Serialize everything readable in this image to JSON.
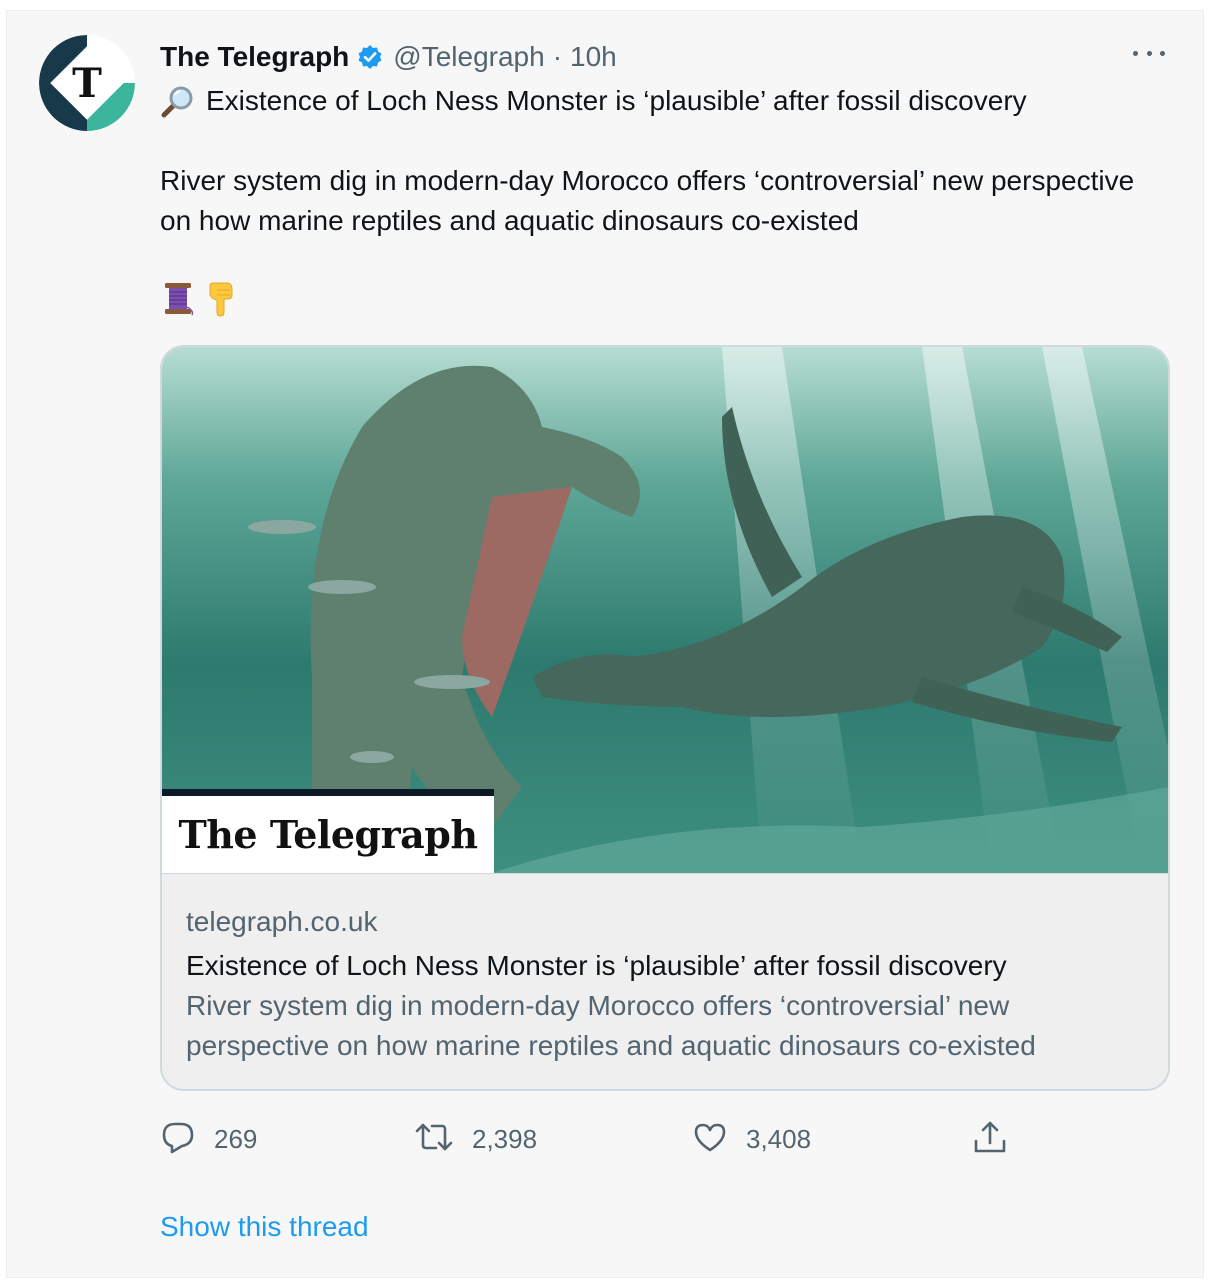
{
  "tweet": {
    "display_name": "The Telegraph",
    "verified": true,
    "handle": "@Telegraph",
    "separator": "·",
    "time": "10h",
    "lead_emoji": "magnifying-glass-emoji",
    "line1": "Existence of Loch Ness Monster is ‘plausible’ after fossil discovery",
    "paragraph2": "River system dig in modern-day Morocco offers ‘controversial’ new perspective on how marine reptiles and aquatic dinosaurs co-existed",
    "emojis": [
      "thread-spool-emoji",
      "pointing-down-emoji"
    ],
    "card": {
      "image_brand": "The Telegraph",
      "domain": "telegraph.co.uk",
      "title": "Existence of Loch Ness Monster is ‘plausible’ after fossil discovery",
      "description": "River system dig in modern-day Morocco offers ‘controversial’ new perspective on how marine reptiles and aquatic dinosaurs co-existed"
    },
    "actions": {
      "replies": "269",
      "retweets": "2,398",
      "likes": "3,408"
    },
    "show_thread": "Show this thread"
  },
  "colors": {
    "accent": "#1d9bf0",
    "secondary_text": "#536471",
    "avatar_dark": "#17394a",
    "avatar_teal": "#3bb59b"
  }
}
